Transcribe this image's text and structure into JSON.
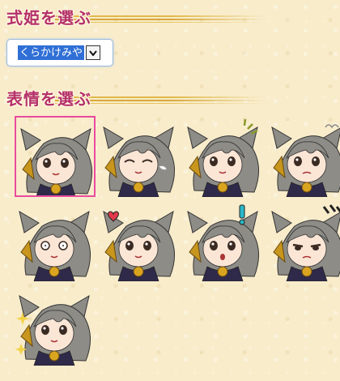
{
  "section1": {
    "title": "式姫を選ぶ"
  },
  "character_select": {
    "value": "くらかけみや"
  },
  "section2": {
    "title": "表情を選ぶ"
  },
  "colors": {
    "title": "#b5306a",
    "selected_border": "#e94b9e",
    "hair": "#8d8c86"
  },
  "expressions": [
    {
      "name": "normal",
      "selected": true
    },
    {
      "name": "wink-sigh",
      "selected": false
    },
    {
      "name": "annoyed",
      "selected": false
    },
    {
      "name": "troubled",
      "selected": false
    },
    {
      "name": "blank",
      "selected": false
    },
    {
      "name": "heart",
      "selected": false
    },
    {
      "name": "surprised",
      "selected": false
    },
    {
      "name": "irritated",
      "selected": false
    },
    {
      "name": "sparkle",
      "selected": false
    }
  ]
}
